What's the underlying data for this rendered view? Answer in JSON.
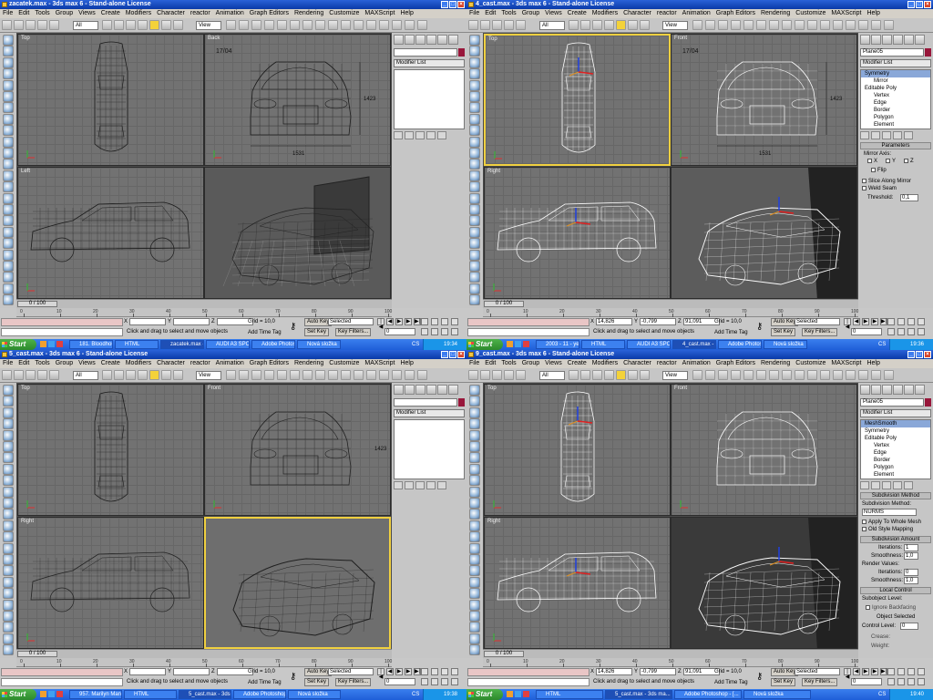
{
  "menus": [
    "File",
    "Edit",
    "Tools",
    "Group",
    "Views",
    "Create",
    "Modifiers",
    "Character",
    "reactor",
    "Animation",
    "Graph Editors",
    "Rendering",
    "Customize",
    "MAXScript",
    "Help"
  ],
  "common": {
    "all_filter": "All",
    "view_dropdown": "View",
    "modifier_list": "Modifier List",
    "time_slider": "0 / 100",
    "prompt": "Click and drag to select and move objects",
    "add_time_tag": "Add Time Tag",
    "grid": "Grid = 10,0",
    "auto_key": "Auto Key",
    "set_key": "Set Key",
    "selected": "Selected",
    "key_filters": "Key Filters...",
    "frame": "0",
    "start": "Start",
    "cs": "CS",
    "x_label": "X",
    "y_label": "Y",
    "z_label": "Z",
    "ticks": [
      "0",
      "10",
      "20",
      "30",
      "40",
      "50",
      "60",
      "70",
      "80",
      "90",
      "100"
    ]
  },
  "windows": [
    {
      "title": "zacatek.max - 3ds max 6 - Stand-alone License",
      "viewports": [
        "Top",
        "Back",
        "Left",
        "Perspective"
      ],
      "active_viewport": "",
      "object_name": "",
      "stack": [],
      "coords": {
        "x": "",
        "y": "",
        "z": ""
      },
      "taskbar": [
        "181. Bloodhound...",
        "HTML",
        "zacatek.max - 3d...",
        "AUDI A3 SPORTB...",
        "Adobe Photosho...",
        "Nová složka"
      ],
      "active_task": 2,
      "clock": "19:34"
    },
    {
      "title": "4_cast.max - 3ds max 6 - Stand-alone License",
      "viewports": [
        "Top",
        "Front",
        "Right",
        "Perspective"
      ],
      "active_viewport": "Top",
      "object_name": "Plane05",
      "stack": [
        "Symmetry",
        "Mirror",
        "Editable Poly",
        "Vertex",
        "Edge",
        "Border",
        "Polygon",
        "Element"
      ],
      "stack_selected": 0,
      "coords": {
        "x": "14,826",
        "y": "-0,799",
        "z": "91,091"
      },
      "params": {
        "header": "Parameters",
        "mirror_axis": "Mirror Axis:",
        "axes": [
          "X",
          "Y",
          "Z"
        ],
        "flip": "Flip",
        "slice": "Slice Along Mirror",
        "weld": "Weld Seam",
        "threshold_label": "Threshold:",
        "threshold": "0,1"
      },
      "taskbar": [
        "2003 - 11 - years...",
        "HTML",
        "AUDI A3 SPORTB...",
        "4_cast.max - 3ds...",
        "Adobe Photosho...",
        "Nová složka"
      ],
      "active_task": 3,
      "clock": "19:36"
    },
    {
      "title": "5_cast.max - 3ds max 6 - Stand-alone License",
      "viewports": [
        "Top",
        "Front",
        "Right",
        "Perspective"
      ],
      "active_viewport": "Perspective",
      "object_name": "",
      "stack": [],
      "coords": {
        "x": "",
        "y": "",
        "z": ""
      },
      "taskbar": [
        "957. Marilyn Manson...",
        "HTML",
        "5_cast.max - 3ds ma...",
        "Adobe Photoshop - [...",
        "Nová složka"
      ],
      "active_task": 2,
      "clock": "19:38"
    },
    {
      "title": "9_cast.max - 3ds max 6 - Stand-alone License",
      "viewports": [
        "Top",
        "Front",
        "Right",
        "Perspective"
      ],
      "active_viewport": "",
      "object_name": "Plane05",
      "stack": [
        "MeshSmooth",
        "Symmetry",
        "Editable Poly",
        "Vertex",
        "Edge",
        "Border",
        "Polygon",
        "Element"
      ],
      "stack_selected": 0,
      "coords": {
        "x": "14,826",
        "y": "-0,799",
        "z": "91,091"
      },
      "meshsmooth": {
        "subdivision_method_header": "Subdivision Method",
        "subdivision_method_label": "Subdivision Method:",
        "method": "NURMS",
        "apply_whole": "Apply To Whole Mesh",
        "old_style": "Old Style Mapping",
        "amount_header": "Subdivision Amount",
        "iterations_label": "Iterations:",
        "iterations": "1",
        "smoothness_label": "Smoothness:",
        "smoothness": "1,0",
        "render_values": "Render Values:",
        "r_iterations": "0",
        "r_smoothness": "1,0",
        "local_control": "Local Control",
        "subobject_level": "Subobject Level:",
        "ignore_backfacing": "Ignore Backfacing",
        "object_selected": "Object Selected",
        "control_level_label": "Control Level:",
        "control_level": "0",
        "crease_label": "Crease:",
        "weight_label": "Weight:"
      },
      "taskbar": [
        "HTML",
        "5_cast.max - 3ds ma...",
        "Adobe Photoshop - [...",
        "Nová složka"
      ],
      "active_task": 1,
      "clock": "19:40"
    }
  ],
  "dimensions": {
    "height_front": "1423",
    "width_front": "1531",
    "front_note": "17/04"
  }
}
